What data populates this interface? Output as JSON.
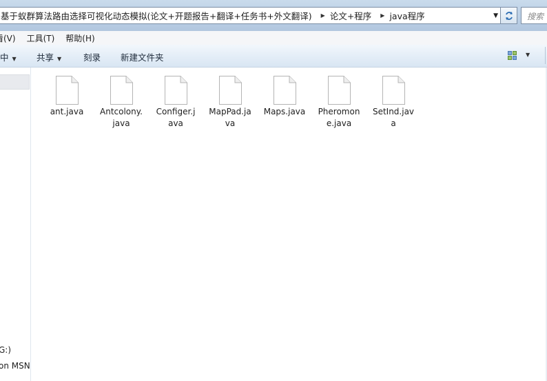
{
  "address": {
    "crumbs": [
      "基于蚁群算法路由选择可视化动态模拟(论文+开题报告+翻译+任务书+外文翻译)",
      "论文+程序",
      "java程序"
    ]
  },
  "search": {
    "placeholder": "搜索"
  },
  "menu": [
    "看(V)",
    "工具(T)",
    "帮助(H)"
  ],
  "toolbar": {
    "include_label": "中",
    "share_label": "共享",
    "burn_label": "刻录",
    "new_folder_label": "新建文件夹"
  },
  "nav": {
    "drive_label": "G:)",
    "msn_label": "on MSN"
  },
  "files": [
    {
      "line1": "ant.java",
      "line2": ""
    },
    {
      "line1": "Antcolony.",
      "line2": "java"
    },
    {
      "line1": "Configer.j",
      "line2": "ava"
    },
    {
      "line1": "MapPad.ja",
      "line2": "va"
    },
    {
      "line1": "Maps.java",
      "line2": ""
    },
    {
      "line1": "Pheromon",
      "line2": "e.java"
    },
    {
      "line1": "SetInd.jav",
      "line2": "a"
    }
  ],
  "icons": {
    "file": "document-icon",
    "refresh": "refresh-icon",
    "view": "view-options-icon"
  }
}
